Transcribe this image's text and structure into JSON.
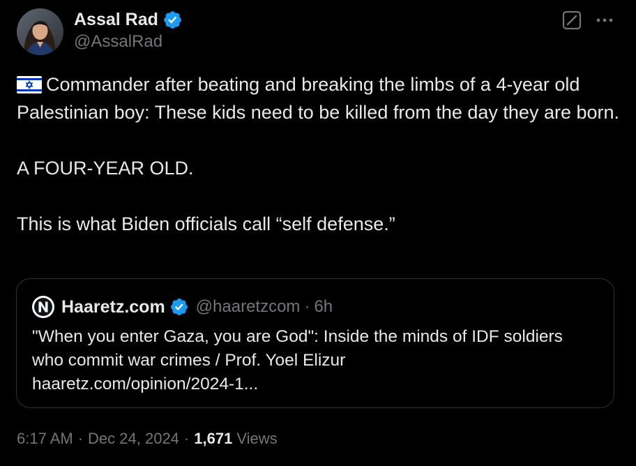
{
  "author": {
    "display_name": "Assal Rad",
    "handle": "@AssalRad",
    "verified": true,
    "avatar_icon": "profile-photo"
  },
  "actions": {
    "grok_icon": "grok-icon",
    "more_icon": "more-icon"
  },
  "tweet": {
    "flag_icon": "israel-flag-icon",
    "paragraph_1": "Commander after beating and breaking the limbs of a 4-year old Palestinian boy: These kids need to be killed from the day they are born.",
    "paragraph_2": "A FOUR-YEAR OLD.",
    "paragraph_3": "This is what Biden officials call “self defense.”"
  },
  "quote": {
    "logo_icon": "haaretz-logo-icon",
    "name": "Haaretz.com",
    "verified": true,
    "handle": "@haaretzcom",
    "separator": "·",
    "time": "6h",
    "text_line_1": "\"When you enter Gaza, you are God\": Inside the minds of IDF soldiers",
    "text_line_2": "who commit war crimes / Prof. Yoel Elizur",
    "text_line_3": "haaretz.com/opinion/2024-1..."
  },
  "meta": {
    "time": "6:17 AM",
    "date": "Dec 24, 2024",
    "separator": "·",
    "views_count": "1,671",
    "views_label": "Views"
  },
  "colors": {
    "background": "#000000",
    "text_primary": "#e7e9ea",
    "text_secondary": "#71767b",
    "border": "#2f3336",
    "verified_blue": "#1d9bf0"
  }
}
